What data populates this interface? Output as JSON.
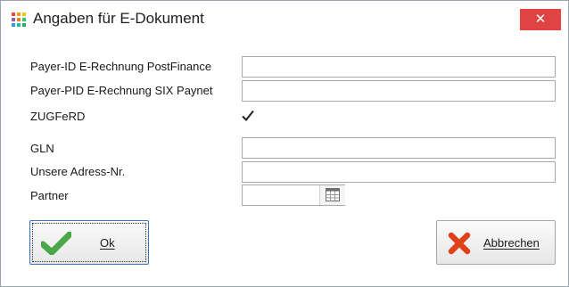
{
  "window": {
    "title": "Angaben für E-Dokument",
    "close_glyph": "✕",
    "close_color": "#e04343"
  },
  "form": {
    "payer_id_label": "Payer-ID E-Rechnung PostFinance",
    "payer_id_value": "",
    "payer_pid_label": "Payer-PID E-Rechnung SIX Paynet",
    "payer_pid_value": "",
    "zugferd_label": "ZUGFeRD",
    "zugferd_checked": true,
    "gln_label": "GLN",
    "gln_value": "",
    "adress_label": "Unsere Adress-Nr.",
    "adress_value": "",
    "partner_label": "Partner",
    "partner_value": ""
  },
  "buttons": {
    "ok_label": "Ok",
    "cancel_label": "Abbrechen",
    "ok_icon": "checkmark-icon",
    "cancel_icon": "x-mark-icon",
    "ok_icon_color": "#4aa84a",
    "cancel_icon_color": "#e0401a"
  }
}
